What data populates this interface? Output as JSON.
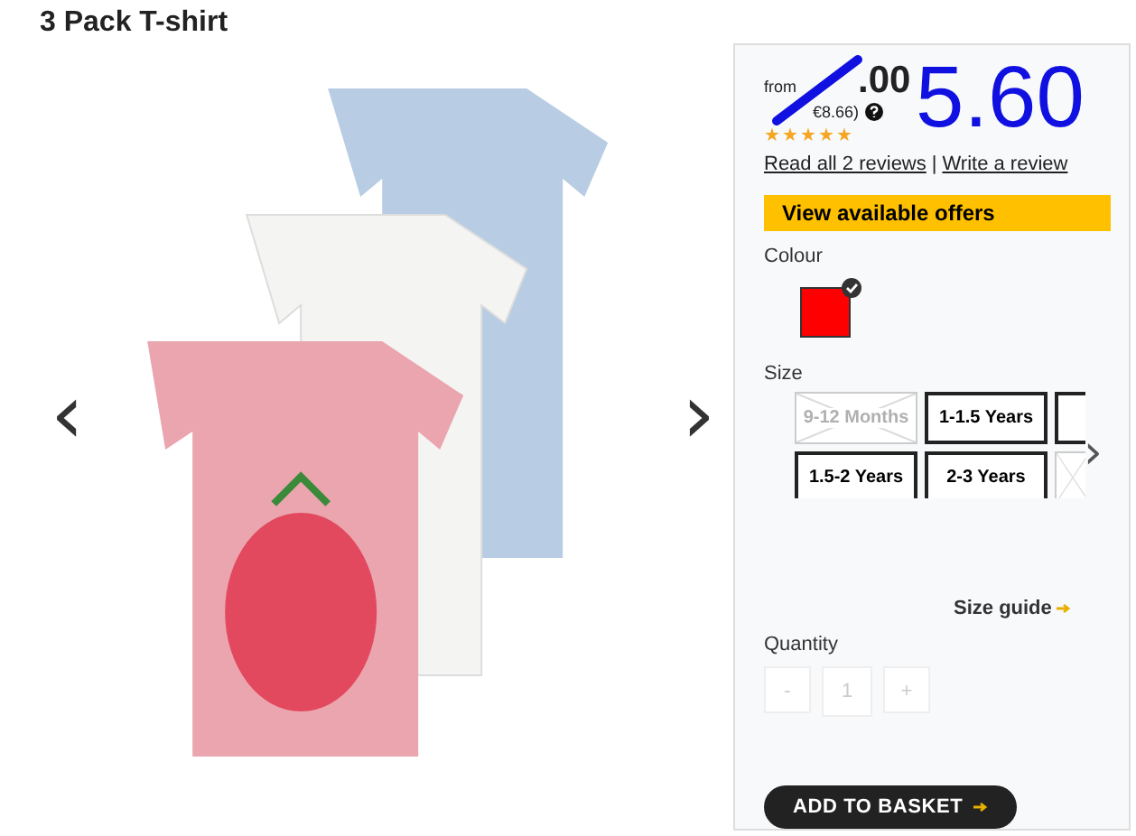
{
  "title": "3 Pack T-shirt",
  "gallery": {
    "prev": "‹",
    "next": "›"
  },
  "price": {
    "prefix": "from",
    "amount": ".00",
    "secondary": "€8.66)",
    "annotation": "5.60",
    "stars": 5
  },
  "reviews": {
    "read": "Read all 2 reviews",
    "separator": "|",
    "write": "Write a review"
  },
  "offers_button": "View available offers",
  "colour": {
    "label": "Colour",
    "swatches": [
      {
        "color": "#ff0000",
        "selected": true
      }
    ]
  },
  "size": {
    "label": "Size",
    "options": [
      {
        "label": "9-12 Months",
        "disabled": true,
        "selected": false
      },
      {
        "label": "1-1.5 Years",
        "disabled": false,
        "selected": false
      },
      {
        "disabled": false,
        "selected": false
      },
      {
        "label": "1.5-2 Years",
        "disabled": false,
        "selected": false
      },
      {
        "label": "2-3 Years",
        "disabled": false,
        "selected": false
      },
      {
        "disabled": true,
        "selected": false
      }
    ],
    "next": "›"
  },
  "size_guide": "Size guide",
  "quantity": {
    "label": "Quantity",
    "minus": "-",
    "value": "1",
    "plus": "+"
  },
  "basket_button": "ADD TO BASKET"
}
